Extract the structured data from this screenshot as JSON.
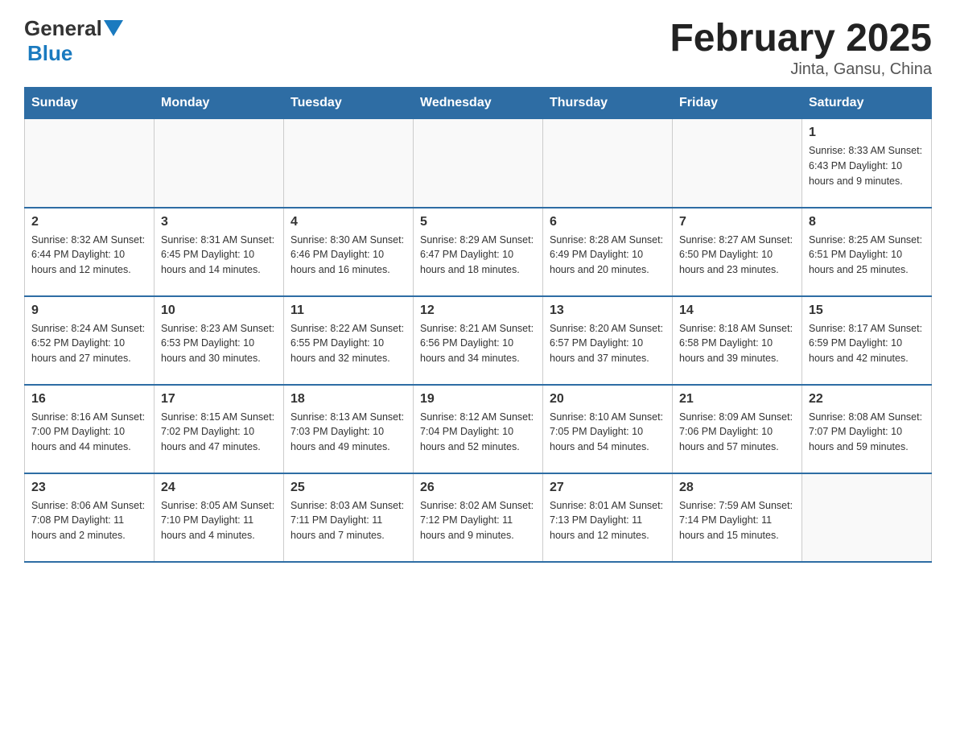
{
  "logo": {
    "general": "General",
    "blue": "Blue"
  },
  "title": "February 2025",
  "subtitle": "Jinta, Gansu, China",
  "days_of_week": [
    "Sunday",
    "Monday",
    "Tuesday",
    "Wednesday",
    "Thursday",
    "Friday",
    "Saturday"
  ],
  "weeks": [
    [
      {
        "day": "",
        "info": ""
      },
      {
        "day": "",
        "info": ""
      },
      {
        "day": "",
        "info": ""
      },
      {
        "day": "",
        "info": ""
      },
      {
        "day": "",
        "info": ""
      },
      {
        "day": "",
        "info": ""
      },
      {
        "day": "1",
        "info": "Sunrise: 8:33 AM\nSunset: 6:43 PM\nDaylight: 10 hours and 9 minutes."
      }
    ],
    [
      {
        "day": "2",
        "info": "Sunrise: 8:32 AM\nSunset: 6:44 PM\nDaylight: 10 hours and 12 minutes."
      },
      {
        "day": "3",
        "info": "Sunrise: 8:31 AM\nSunset: 6:45 PM\nDaylight: 10 hours and 14 minutes."
      },
      {
        "day": "4",
        "info": "Sunrise: 8:30 AM\nSunset: 6:46 PM\nDaylight: 10 hours and 16 minutes."
      },
      {
        "day": "5",
        "info": "Sunrise: 8:29 AM\nSunset: 6:47 PM\nDaylight: 10 hours and 18 minutes."
      },
      {
        "day": "6",
        "info": "Sunrise: 8:28 AM\nSunset: 6:49 PM\nDaylight: 10 hours and 20 minutes."
      },
      {
        "day": "7",
        "info": "Sunrise: 8:27 AM\nSunset: 6:50 PM\nDaylight: 10 hours and 23 minutes."
      },
      {
        "day": "8",
        "info": "Sunrise: 8:25 AM\nSunset: 6:51 PM\nDaylight: 10 hours and 25 minutes."
      }
    ],
    [
      {
        "day": "9",
        "info": "Sunrise: 8:24 AM\nSunset: 6:52 PM\nDaylight: 10 hours and 27 minutes."
      },
      {
        "day": "10",
        "info": "Sunrise: 8:23 AM\nSunset: 6:53 PM\nDaylight: 10 hours and 30 minutes."
      },
      {
        "day": "11",
        "info": "Sunrise: 8:22 AM\nSunset: 6:55 PM\nDaylight: 10 hours and 32 minutes."
      },
      {
        "day": "12",
        "info": "Sunrise: 8:21 AM\nSunset: 6:56 PM\nDaylight: 10 hours and 34 minutes."
      },
      {
        "day": "13",
        "info": "Sunrise: 8:20 AM\nSunset: 6:57 PM\nDaylight: 10 hours and 37 minutes."
      },
      {
        "day": "14",
        "info": "Sunrise: 8:18 AM\nSunset: 6:58 PM\nDaylight: 10 hours and 39 minutes."
      },
      {
        "day": "15",
        "info": "Sunrise: 8:17 AM\nSunset: 6:59 PM\nDaylight: 10 hours and 42 minutes."
      }
    ],
    [
      {
        "day": "16",
        "info": "Sunrise: 8:16 AM\nSunset: 7:00 PM\nDaylight: 10 hours and 44 minutes."
      },
      {
        "day": "17",
        "info": "Sunrise: 8:15 AM\nSunset: 7:02 PM\nDaylight: 10 hours and 47 minutes."
      },
      {
        "day": "18",
        "info": "Sunrise: 8:13 AM\nSunset: 7:03 PM\nDaylight: 10 hours and 49 minutes."
      },
      {
        "day": "19",
        "info": "Sunrise: 8:12 AM\nSunset: 7:04 PM\nDaylight: 10 hours and 52 minutes."
      },
      {
        "day": "20",
        "info": "Sunrise: 8:10 AM\nSunset: 7:05 PM\nDaylight: 10 hours and 54 minutes."
      },
      {
        "day": "21",
        "info": "Sunrise: 8:09 AM\nSunset: 7:06 PM\nDaylight: 10 hours and 57 minutes."
      },
      {
        "day": "22",
        "info": "Sunrise: 8:08 AM\nSunset: 7:07 PM\nDaylight: 10 hours and 59 minutes."
      }
    ],
    [
      {
        "day": "23",
        "info": "Sunrise: 8:06 AM\nSunset: 7:08 PM\nDaylight: 11 hours and 2 minutes."
      },
      {
        "day": "24",
        "info": "Sunrise: 8:05 AM\nSunset: 7:10 PM\nDaylight: 11 hours and 4 minutes."
      },
      {
        "day": "25",
        "info": "Sunrise: 8:03 AM\nSunset: 7:11 PM\nDaylight: 11 hours and 7 minutes."
      },
      {
        "day": "26",
        "info": "Sunrise: 8:02 AM\nSunset: 7:12 PM\nDaylight: 11 hours and 9 minutes."
      },
      {
        "day": "27",
        "info": "Sunrise: 8:01 AM\nSunset: 7:13 PM\nDaylight: 11 hours and 12 minutes."
      },
      {
        "day": "28",
        "info": "Sunrise: 7:59 AM\nSunset: 7:14 PM\nDaylight: 11 hours and 15 minutes."
      },
      {
        "day": "",
        "info": ""
      }
    ]
  ]
}
